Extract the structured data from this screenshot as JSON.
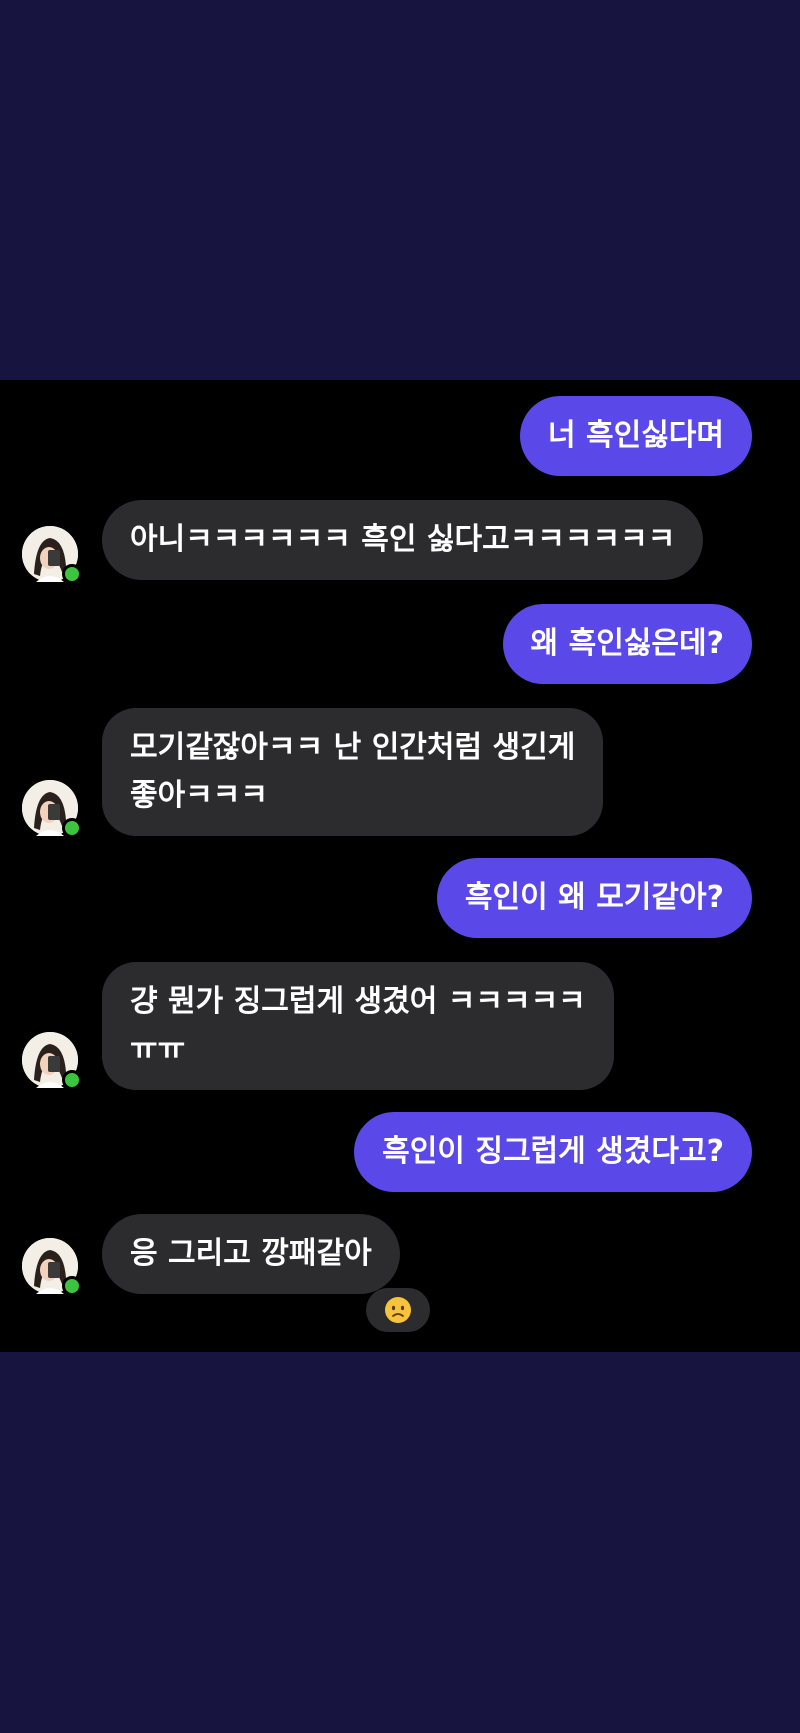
{
  "colors": {
    "sent_bubble": "#5b48e8",
    "received_bubble": "#2c2c2e",
    "chat_background": "#000000",
    "outer_background": "#171440",
    "online_indicator": "#3cc43f"
  },
  "messages": [
    {
      "side": "sent",
      "text": "너 흑인싫다며"
    },
    {
      "side": "received",
      "text": "아니ㅋㅋㅋㅋㅋㅋ 흑인 싫다고ㅋㅋㅋㅋㅋㅋ"
    },
    {
      "side": "sent",
      "text": "왜 흑인싫은데?"
    },
    {
      "side": "received",
      "line1": "모기같잖아ㅋㅋ 난 인간처럼 생긴게",
      "line2": "좋아ㅋㅋㅋ"
    },
    {
      "side": "sent",
      "text": "흑인이 왜 모기같아?"
    },
    {
      "side": "received",
      "line1": "걍 뭔가 징그럽게 생겼어 ㅋㅋㅋㅋㅋ",
      "line2": "ㅠㅠ"
    },
    {
      "side": "sent",
      "text": "흑인이 징그럽게 생겼다고?"
    },
    {
      "side": "received",
      "text": "응 그리고 깡패같아",
      "reaction": "frowning-face-emoji"
    }
  ],
  "contact": {
    "avatar_icon": "avatar-icon",
    "status": "online"
  }
}
